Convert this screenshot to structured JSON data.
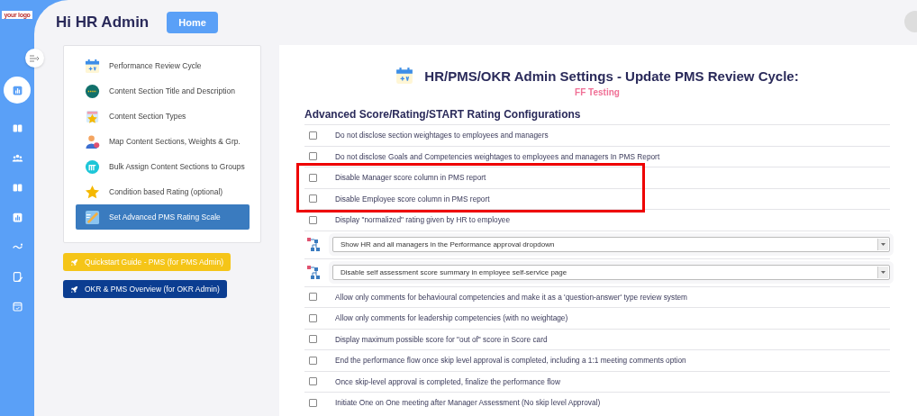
{
  "sidebar": {
    "logo": "your logo",
    "items": [
      {
        "selected": true
      },
      {
        "selected": false
      },
      {
        "selected": false
      },
      {
        "selected": false
      },
      {
        "selected": false
      },
      {
        "selected": false
      },
      {
        "selected": false
      },
      {
        "selected": false
      }
    ]
  },
  "header": {
    "greeting": "Hi HR Admin",
    "home_button": "Home"
  },
  "menu": {
    "items": [
      {
        "label": "Performance Review Cycle",
        "selected": false
      },
      {
        "label": "Content Section Title and Description",
        "selected": false
      },
      {
        "label": "Content Section Types",
        "selected": false
      },
      {
        "label": "Map Content Sections, Weights & Grp.",
        "selected": false
      },
      {
        "label": "Bulk Assign Content Sections to Groups",
        "selected": false
      },
      {
        "label": "Condition based Rating (optional)",
        "selected": false
      },
      {
        "label": "Set Advanced PMS Rating Scale",
        "selected": true
      }
    ]
  },
  "guide_buttons": [
    {
      "label": "Quickstart Guide - PMS (for PMS Admin)",
      "color": "#f5c518"
    },
    {
      "label": "OKR & PMS Overview (for OKR Admin)",
      "color": "#0b3d91"
    }
  ],
  "settings": {
    "title": "HR/PMS/OKR Admin Settings - Update PMS Review Cycle:",
    "subtitle": "FF Testing",
    "section_heading": "Advanced Score/Rating/START Rating Configurations",
    "rows": [
      {
        "kind": "checkbox",
        "label": "Do not disclose section weightages to employees and managers",
        "checked": false,
        "highlighted": false
      },
      {
        "kind": "checkbox",
        "label": "Do not disclose Goals and Competencies weightages to employees and managers In PMS Report",
        "checked": false,
        "highlighted": false
      },
      {
        "kind": "checkbox",
        "label": "Disable Manager score column in PMS report",
        "checked": false,
        "highlighted": true
      },
      {
        "kind": "checkbox",
        "label": "Disable Employee score column in PMS report",
        "checked": false,
        "highlighted": true
      },
      {
        "kind": "checkbox",
        "label": "Display \"normalized\" rating given by HR to employee",
        "checked": false,
        "highlighted": false
      },
      {
        "kind": "select",
        "label": "Show HR and all managers in the Performance approval dropdown",
        "highlighted": false
      },
      {
        "kind": "select",
        "label": "Disable self assessment score summary in employee self-service page",
        "highlighted": false
      },
      {
        "kind": "checkbox",
        "label": "Allow only comments for behavioural competencies and make it as a 'question-answer' type review system",
        "checked": false,
        "highlighted": false
      },
      {
        "kind": "checkbox",
        "label": "Allow only comments for leadership competencies (with no weightage)",
        "checked": false,
        "highlighted": false
      },
      {
        "kind": "checkbox",
        "label": "Display maximum possible score for \"out of\" score in Score card",
        "checked": false,
        "highlighted": false
      },
      {
        "kind": "checkbox",
        "label": "End the performance flow once skip level approval is completed, including a 1:1 meeting comments option",
        "checked": false,
        "highlighted": false
      },
      {
        "kind": "checkbox",
        "label": "Once skip-level approval is completed, finalize the performance flow",
        "checked": false,
        "highlighted": false
      },
      {
        "kind": "checkbox",
        "label": "Initiate One on One meeting after Manager Assessment (No skip level Approval)",
        "checked": false,
        "highlighted": false
      }
    ]
  }
}
